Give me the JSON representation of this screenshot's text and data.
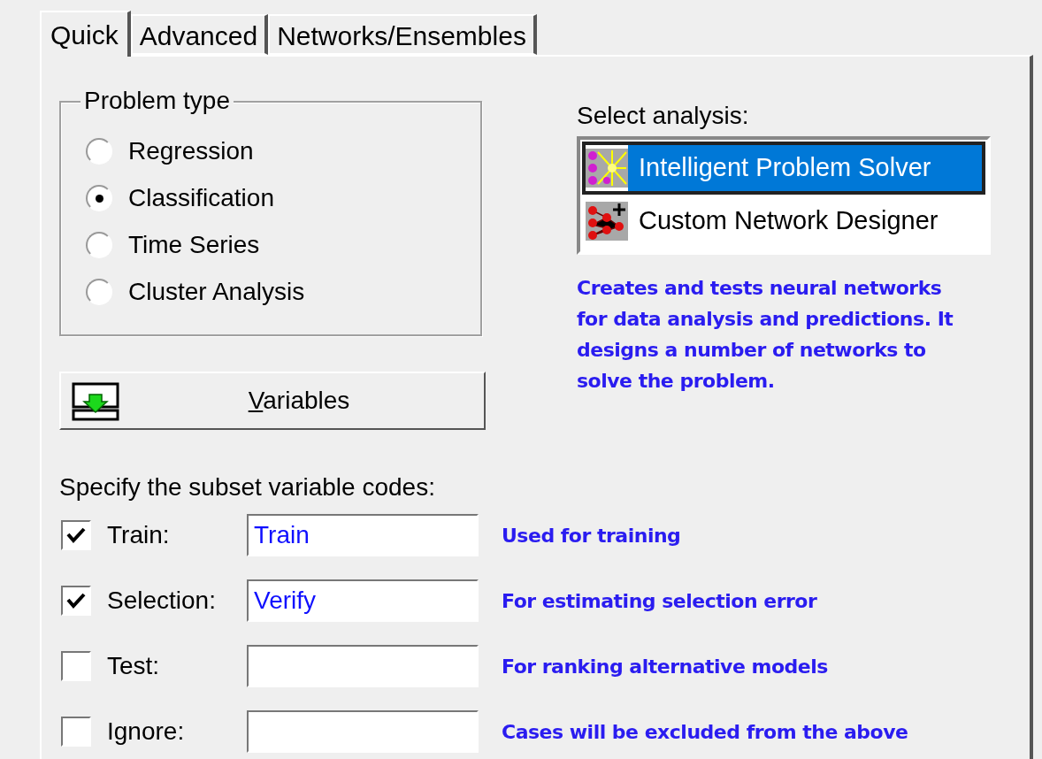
{
  "tabs": [
    {
      "label": "Quick",
      "selected": true
    },
    {
      "label": "Advanced",
      "selected": false
    },
    {
      "label": "Networks/Ensembles",
      "selected": false
    }
  ],
  "problem_type": {
    "title": "Problem type",
    "options": [
      {
        "label": "Regression",
        "selected": false
      },
      {
        "label": "Classification",
        "selected": true
      },
      {
        "label": "Time Series",
        "selected": false
      },
      {
        "label": "Cluster Analysis",
        "selected": false
      }
    ]
  },
  "analysis": {
    "label": "Select analysis:",
    "items": [
      {
        "label": "Intelligent Problem Solver",
        "selected": true,
        "kind": "solver"
      },
      {
        "label": "Custom Network Designer",
        "selected": false,
        "kind": "designer"
      }
    ],
    "description": "Creates and tests neural networks for data analysis and predictions. It designs a number of networks to solve the problem."
  },
  "variables_button": {
    "label": "Variables"
  },
  "subsets": {
    "label": "Specify the subset variable codes:",
    "rows": [
      {
        "label": "Train:",
        "checked": true,
        "value": "Train",
        "note": "Used for training"
      },
      {
        "label": "Selection:",
        "checked": true,
        "value": "Verify",
        "note": "For estimating selection error"
      },
      {
        "label": "Test:",
        "checked": false,
        "value": "",
        "note": "For ranking alternative models"
      },
      {
        "label": "Ignore:",
        "checked": false,
        "value": "",
        "note": "Cases will be excluded from the above"
      }
    ]
  }
}
